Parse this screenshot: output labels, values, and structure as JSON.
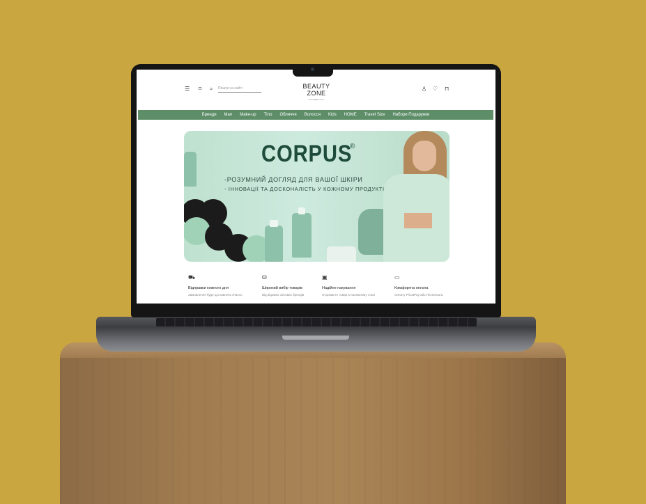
{
  "header": {
    "search_placeholder": "Пошук на сайті",
    "logo_line1": "BEAUTY",
    "logo_line2": "ZONE",
    "logo_line3": "COSMETICS",
    "icons": [
      "menu-icon",
      "tag-icon",
      "search-icon",
      "user-icon",
      "heart-icon",
      "cart-icon"
    ]
  },
  "nav": {
    "items": [
      "Бренди",
      "Man",
      "Make-up",
      "Тіло",
      "Обличчя",
      "Волосся",
      "Kids",
      "HOME",
      "Travel Size",
      "Набори Подарунки"
    ]
  },
  "banner": {
    "brand": "CORPUS",
    "registered": "®",
    "tagline1": "-РОЗУМНИЙ ДОГЛЯД ДЛЯ ВАШОЇ ШКІРИ",
    "tagline2": "- ІННОВАЦІЇ ТА ДОСКОНАЛІСТЬ У КОЖНОМУ ПРОДУКТІ"
  },
  "features": [
    {
      "icon": "truck-icon",
      "title": "Відправки кожного дня",
      "subtitle": "Замовлення буде доставлено вчасно"
    },
    {
      "icon": "boxes-icon",
      "title": "Широкий вибір товарів",
      "subtitle": "Від відомих світових брендів"
    },
    {
      "icon": "box-icon",
      "title": "Надійне пакування",
      "subtitle": "Отримаєте товар в належному стані"
    },
    {
      "icon": "payment-icon",
      "title": "Комфортна оплата",
      "subtitle": "Оплату PrivatPay або Післяплата"
    }
  ],
  "colors": {
    "background": "#c9a640",
    "nav": "#5d8e68",
    "brand_text": "#1e4b3b",
    "banner": "#c6e5d4"
  }
}
